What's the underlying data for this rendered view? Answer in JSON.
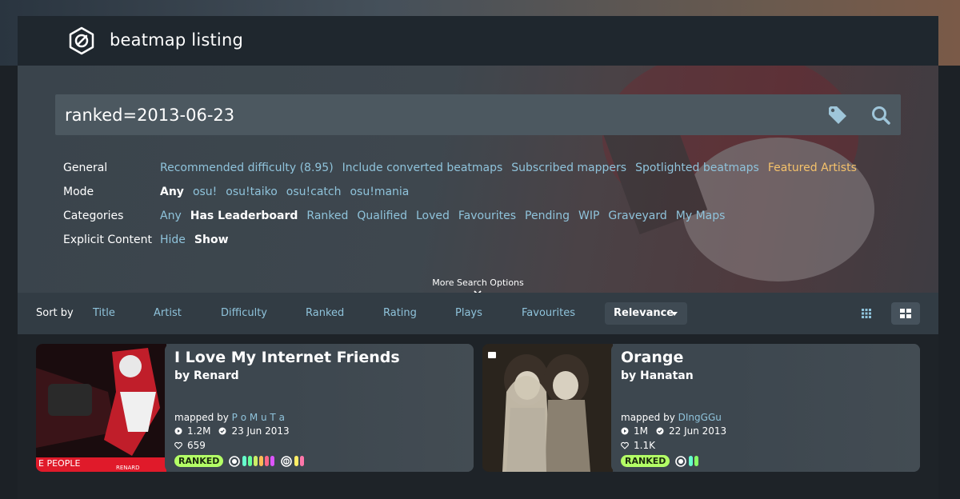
{
  "header": {
    "title": "beatmap listing"
  },
  "search": {
    "query": "ranked=2013-06-23"
  },
  "filters": {
    "general": {
      "label": "General",
      "options": [
        "Recommended difficulty (8.95)",
        "Include converted beatmaps",
        "Subscribed mappers",
        "Spotlighted beatmaps",
        "Featured Artists"
      ]
    },
    "mode": {
      "label": "Mode",
      "options": [
        "Any",
        "osu!",
        "osu!taiko",
        "osu!catch",
        "osu!mania"
      ],
      "active": "Any"
    },
    "categories": {
      "label": "Categories",
      "options": [
        "Any",
        "Has Leaderboard",
        "Ranked",
        "Qualified",
        "Loved",
        "Favourites",
        "Pending",
        "WIP",
        "Graveyard",
        "My Maps"
      ],
      "active": "Has Leaderboard"
    },
    "explicit": {
      "label": "Explicit Content",
      "options": [
        "Hide",
        "Show"
      ],
      "active": "Show"
    },
    "more_options": "More Search Options"
  },
  "sort": {
    "label": "Sort by",
    "items": [
      "Title",
      "Artist",
      "Difficulty",
      "Ranked",
      "Rating",
      "Plays",
      "Favourites"
    ],
    "active": "Relevance"
  },
  "cards": [
    {
      "title": "I Love My Internet Friends",
      "artist": "by Renard",
      "mapped_by_label": "mapped by",
      "mapper": "P o M u T a",
      "plays": "1.2M",
      "date": "23 Jun 2013",
      "favourites": "659",
      "status": "RANKED",
      "thumb_text": "E PEOPLE",
      "thumb_sub": "RENARD",
      "diff_colors_std": [
        "#66ffcc",
        "#66ff99",
        "#ccee66",
        "#ffbb55",
        "#ff6688",
        "#dd55ff"
      ],
      "diff_colors_taiko": [
        "#ffee66",
        "#ff77aa"
      ]
    },
    {
      "title": "Orange",
      "artist": "by Hanatan",
      "mapped_by_label": "mapped by",
      "mapper": "DIngGGu",
      "plays": "1M",
      "date": "22 Jun 2013",
      "favourites": "1.1K",
      "status": "RANKED",
      "diff_colors_std": [
        "#66ffcc",
        "#88ff66"
      ]
    }
  ],
  "colors": {
    "accent": "#8fc3db",
    "featured": "#f5c26b",
    "ranked_badge": "#b3ff66"
  }
}
